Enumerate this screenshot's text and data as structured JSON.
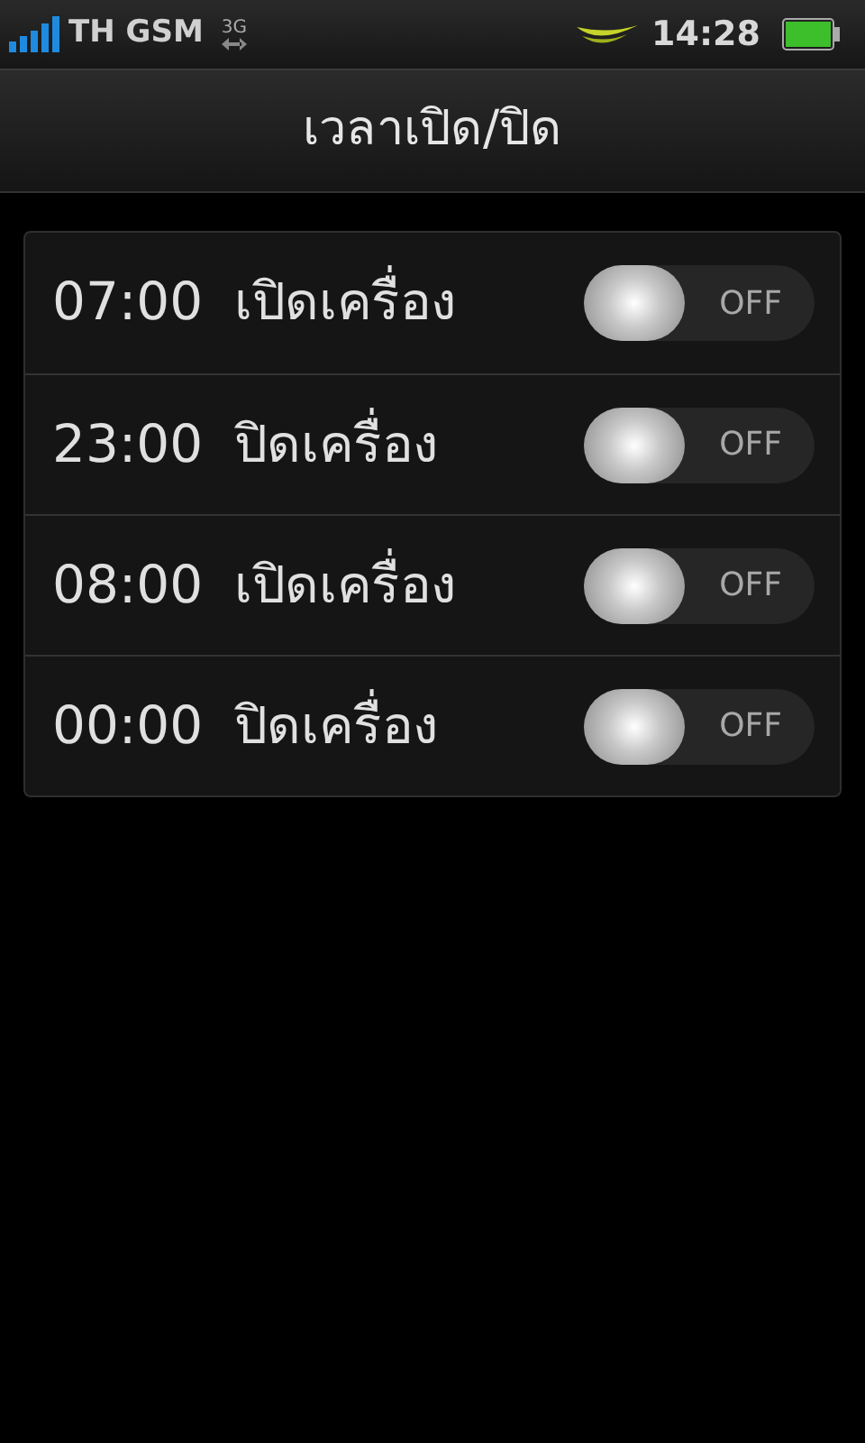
{
  "status_bar": {
    "carrier": "TH GSM",
    "network": "3G",
    "time": "14:28"
  },
  "header": {
    "title": "เวลาเปิด/ปิด"
  },
  "schedules": [
    {
      "time": "07:00",
      "action": "เปิดเครื่อง",
      "toggle": {
        "label": "OFF",
        "on": false
      }
    },
    {
      "time": "23:00",
      "action": "ปิดเครื่อง",
      "toggle": {
        "label": "OFF",
        "on": false
      }
    },
    {
      "time": "08:00",
      "action": "เปิดเครื่อง",
      "toggle": {
        "label": "OFF",
        "on": false
      }
    },
    {
      "time": "00:00",
      "action": "ปิดเครื่อง",
      "toggle": {
        "label": "OFF",
        "on": false
      }
    }
  ]
}
